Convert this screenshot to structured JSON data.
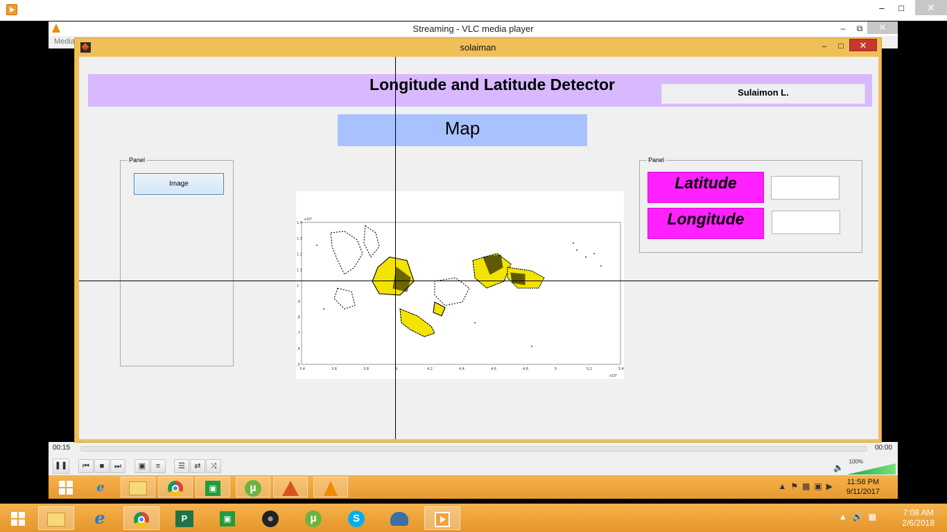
{
  "vlc": {
    "title": "Streaming - VLC media player",
    "menu_label": "Media",
    "elapsed": "00:15",
    "total": "00:00",
    "volume": "100%",
    "minimize": "–",
    "restore": "⧉",
    "close": "✕"
  },
  "outer": {
    "minimize": "–",
    "maximize": "□",
    "close": "✕"
  },
  "figure": {
    "title": "solaiman",
    "minimize": "–",
    "maximize": "□",
    "close": "✕",
    "header_title": "Longitude and Latitude Detector",
    "author": "Sulaimon L.",
    "map_label": "Map",
    "left_panel": {
      "caption": "Panel",
      "image_button": "Image"
    },
    "right_panel": {
      "caption": "Panel",
      "latitude_label": "Latitude",
      "longitude_label": "Longitude",
      "latitude_value": "",
      "longitude_value": ""
    },
    "map_plot": {
      "y_ticks": [
        "1.4",
        "1.3",
        "1.2",
        "1.1",
        "1",
        ".9",
        ".8",
        ".7",
        ".6",
        ".5"
      ],
      "x_ticks": [
        "3.4",
        "3.6",
        "3.8",
        "4",
        "4.2",
        "4.4",
        "4.6",
        "4.8",
        "5",
        "5.2",
        "5.4"
      ],
      "x_multiplier": "x10⁵",
      "y_multiplier": "x10⁵"
    }
  },
  "inner_taskbar": {
    "time": "11:58 PM",
    "date": "9/11/2017"
  },
  "main_taskbar": {
    "time": "7:08 AM",
    "date": "2/6/2018"
  },
  "controls": {
    "pause": "❚❚",
    "prev": "⏮",
    "stop": "■",
    "next": "⏭",
    "fullscreen": "▣",
    "extended": "≡",
    "playlist": "☰",
    "loop": "⇄",
    "shuffle": "⤨"
  }
}
